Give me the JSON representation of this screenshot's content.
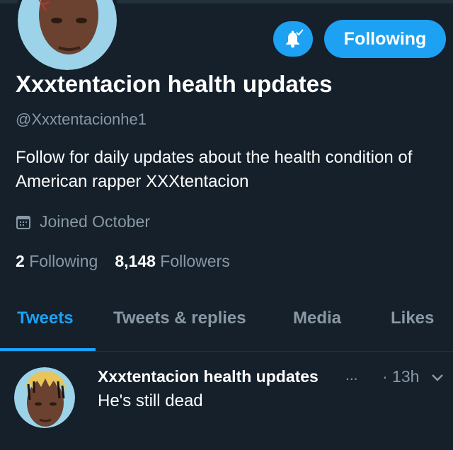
{
  "profile": {
    "display_name": "Xxxtentacion health updates",
    "handle": "@Xxxtentacionhe1",
    "bio": "Follow for daily updates about the health condition of American rapper XXXtentacion",
    "joined": "Joined October",
    "following_count": "2",
    "following_label": "Following",
    "followers_count": "8,148",
    "followers_label": "Followers",
    "avatar_icon": "profile-photo"
  },
  "actions": {
    "notifications_icon": "bell-icon",
    "follow_button_label": "Following"
  },
  "tabs": [
    {
      "label": "Tweets",
      "active": true
    },
    {
      "label": "Tweets & replies",
      "active": false
    },
    {
      "label": "Media",
      "active": false
    },
    {
      "label": "Likes",
      "active": false
    }
  ],
  "tweet": {
    "author": "Xxxtentacion health updates",
    "ellipsis": "...",
    "time": "· 13h",
    "text": "He's still dead"
  },
  "colors": {
    "background": "#15202b",
    "accent": "#1da1f2",
    "secondary_text": "#8899a6"
  }
}
